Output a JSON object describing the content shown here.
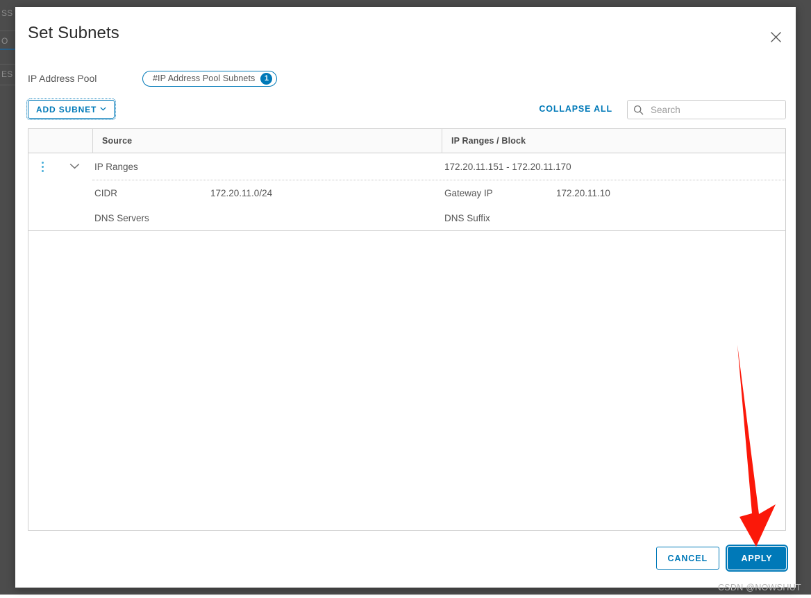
{
  "backdrop": {
    "fragments": [
      "SS",
      "O",
      "ES"
    ]
  },
  "modal": {
    "title": "Set Subnets",
    "close_label": "Close",
    "close_icon": "close-icon"
  },
  "pool": {
    "label": "IP Address Pool",
    "pill_text": "#IP Address Pool Subnets",
    "pill_count": "1"
  },
  "toolbar": {
    "add_subnet_label": "ADD SUBNET",
    "add_subnet_caret": "⌄",
    "collapse_all_label": "COLLAPSE ALL",
    "search_placeholder": "Search",
    "search_value": "",
    "search_icon": "search-icon"
  },
  "table": {
    "columns": [
      "",
      "Source",
      "IP Ranges / Block"
    ],
    "rows": [
      {
        "kebab_icon": "more-vertical-icon",
        "chevron_icon": "chevron-down-icon",
        "source": "IP Ranges",
        "range": "172.20.11.151 - 172.20.11.170",
        "details": [
          {
            "left_key": "CIDR",
            "left_value": "172.20.11.0/24",
            "right_key": "Gateway IP",
            "right_value": "172.20.11.10"
          },
          {
            "left_key": "DNS Servers",
            "left_value": "",
            "right_key": "DNS Suffix",
            "right_value": ""
          }
        ]
      }
    ]
  },
  "footer": {
    "cancel_label": "CANCEL",
    "apply_label": "APPLY"
  },
  "annotation": {
    "arrow_color": "#fb1809",
    "target": "apply-button"
  },
  "watermark": {
    "text": "CSDN @NOWSHUT"
  },
  "colors": {
    "accent": "#0079b8",
    "accent_light": "#49afd9",
    "text": "#565656",
    "backdrop": "#4c4c4c",
    "arrow": "#fb1809"
  }
}
